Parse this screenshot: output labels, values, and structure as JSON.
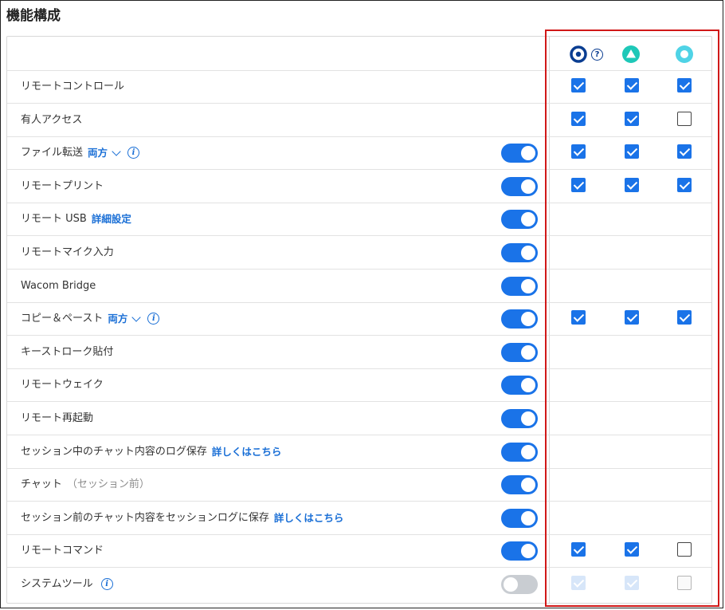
{
  "title": "機能構成",
  "plans": [
    {
      "icon": "target-circle-icon",
      "color": "#0a3d91",
      "help": "?"
    },
    {
      "icon": "triangle-circle-icon",
      "color": "#1ec8b8"
    },
    {
      "icon": "ring-circle-icon",
      "color": "#4fd3e6"
    }
  ],
  "rows": [
    {
      "label": "リモートコントロール",
      "toggle": null,
      "checks": [
        "on",
        "on",
        "on"
      ]
    },
    {
      "label": "有人アクセス",
      "toggle": null,
      "checks": [
        "on",
        "on",
        "off"
      ]
    },
    {
      "label": "ファイル転送",
      "dropdown": "両方",
      "info": true,
      "toggle": true,
      "checks": [
        "on",
        "on",
        "on"
      ]
    },
    {
      "label": "リモートプリント",
      "toggle": true,
      "checks": [
        "on",
        "on",
        "on"
      ]
    },
    {
      "label": "リモート USB",
      "link": "詳細設定",
      "toggle": true,
      "checks": []
    },
    {
      "label": "リモートマイク入力",
      "toggle": true,
      "checks": []
    },
    {
      "label": "Wacom Bridge",
      "toggle": true,
      "checks": []
    },
    {
      "label": "コピー＆ペースト",
      "dropdown": "両方",
      "info": true,
      "toggle": true,
      "checks": [
        "on",
        "on",
        "on"
      ]
    },
    {
      "label": "キーストローク貼付",
      "toggle": true,
      "checks": []
    },
    {
      "label": "リモートウェイク",
      "toggle": true,
      "checks": []
    },
    {
      "label": "リモート再起動",
      "toggle": true,
      "checks": []
    },
    {
      "label": "セッション中のチャット内容のログ保存",
      "link": "詳しくはこちら",
      "toggle": true,
      "checks": []
    },
    {
      "label": "チャット",
      "sub": "（セッション前）",
      "toggle": true,
      "checks": []
    },
    {
      "label": "セッション前のチャット内容をセッションログに保存",
      "link": "詳しくはこちら",
      "toggle": true,
      "checks": []
    },
    {
      "label": "リモートコマンド",
      "toggle": true,
      "checks": [
        "on",
        "on",
        "off"
      ]
    },
    {
      "label": "システムツール",
      "info": true,
      "toggle": false,
      "checks": [
        "dis-on",
        "dis-on",
        "dis-off"
      ]
    }
  ]
}
